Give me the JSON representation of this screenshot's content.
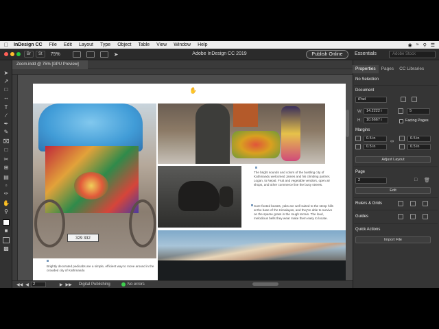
{
  "menubar": {
    "app": "InDesign CC",
    "items": [
      "File",
      "Edit",
      "Layout",
      "Type",
      "Object",
      "Table",
      "View",
      "Window",
      "Help"
    ]
  },
  "titlebar": {
    "br": "Br",
    "st": "St",
    "zoom": "75%",
    "title": "Adobe InDesign CC 2019",
    "publish": "Publish Online",
    "workspace": "Essentials",
    "search_placeholder": "Adobe Stock"
  },
  "document": {
    "tab_title": "Zoom.indd @ 75% [GPU Preview]"
  },
  "captions": {
    "cap1": "Brightly decorated pedicabs are a simple, efficient way to move around in the crowded city of Kathmandu",
    "cap2": "The bright sounds and colors of the bustling city of Kathmandu welcomed James and his climbing partner, Logan, to Nepal. Fruit and vegetable vendors, open air shops, and other commerce line the busy streets.",
    "cap3": "Sure-footed beasts, yaks are well suited to the steep hills at the base of the Himalayas, and they're able to survive on the sparse grass in the rough terrain. The loud, melodious bells they wear make them easy to locate."
  },
  "rickshaw_plate": "329 332",
  "statusbar": {
    "page": "2",
    "profile": "Digital Publishing",
    "errors": "No errors"
  },
  "panel": {
    "tabs": [
      "Properties",
      "Pages",
      "CC Libraries"
    ],
    "no_selection": "No Selection",
    "document_label": "Document",
    "preset": "iPad",
    "w_label": "W:",
    "w_value": "14.2222 i",
    "h_label": "H:",
    "h_value": "10.6667 i",
    "pages_count": "5",
    "facing_pages": "Facing Pages",
    "margins_label": "Margins",
    "margin_values": [
      "0.5 in",
      "0.5 in",
      "0.5 in",
      "0.5 in"
    ],
    "adjust_layout": "Adjust Layout",
    "page_label": "Page",
    "page_value": "2",
    "edit": "Edit",
    "rulers_grids": "Rulers & Grids",
    "guides": "Guides",
    "quick_actions": "Quick Actions",
    "import_file": "Import File"
  },
  "colors": {
    "accent_green": "#3fcf4f",
    "panel_bg": "#353535",
    "doc_bg": "#4d4d4d"
  }
}
